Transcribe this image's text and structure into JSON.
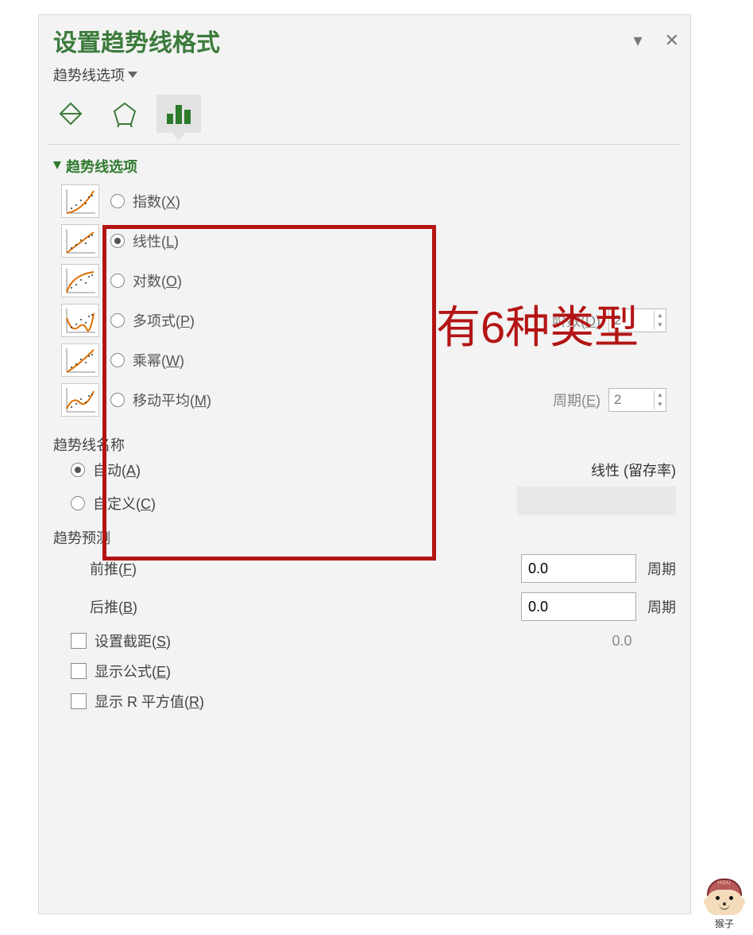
{
  "header": {
    "title": "设置趋势线格式",
    "dropdown_label": "趋势线选项"
  },
  "section_options": {
    "title": "趋势线选项"
  },
  "trend_types": [
    {
      "id": "exp",
      "label_pre": "指数(",
      "key": "X",
      "label_post": ")",
      "selected": false
    },
    {
      "id": "linear",
      "label_pre": "线性(",
      "key": "L",
      "label_post": ")",
      "selected": true
    },
    {
      "id": "log",
      "label_pre": "对数(",
      "key": "O",
      "label_post": ")",
      "selected": false
    },
    {
      "id": "poly",
      "label_pre": "多项式(",
      "key": "P",
      "label_post": ")",
      "selected": false,
      "param_label_pre": "阶数(",
      "param_key": "D",
      "param_label_post": ")",
      "param_value": "2"
    },
    {
      "id": "power",
      "label_pre": "乘幂(",
      "key": "W",
      "label_post": ")",
      "selected": false
    },
    {
      "id": "moving",
      "label_pre": "移动平均(",
      "key": "M",
      "label_post": ")",
      "selected": false,
      "param_label_pre": "周期(",
      "param_key": "E",
      "param_label_post": ")",
      "param_value": "2"
    }
  ],
  "annotation": "有6种类型",
  "trend_name": {
    "section": "趋势线名称",
    "auto_pre": "自动(",
    "auto_key": "A",
    "auto_post": ")",
    "auto_selected": true,
    "auto_value": "线性 (留存率)",
    "custom_pre": "自定义(",
    "custom_key": "C",
    "custom_post": ")",
    "custom_selected": false
  },
  "forecast": {
    "section": "趋势预测",
    "forward_pre": "前推(",
    "forward_key": "F",
    "forward_post": ")",
    "forward_val": "0.0",
    "backward_pre": "后推(",
    "backward_key": "B",
    "backward_post": ")",
    "backward_val": "0.0",
    "unit": "周期"
  },
  "checks": {
    "intercept_pre": "设置截距(",
    "intercept_key": "S",
    "intercept_post": ")",
    "intercept_val": "0.0",
    "equation_pre": "显示公式(",
    "equation_key": "E",
    "equation_post": ")",
    "r2_pre": "显示 R 平方值(",
    "r2_key": "R",
    "r2_post": ")"
  },
  "watermark": "猴子",
  "watermark_top": "HOU"
}
